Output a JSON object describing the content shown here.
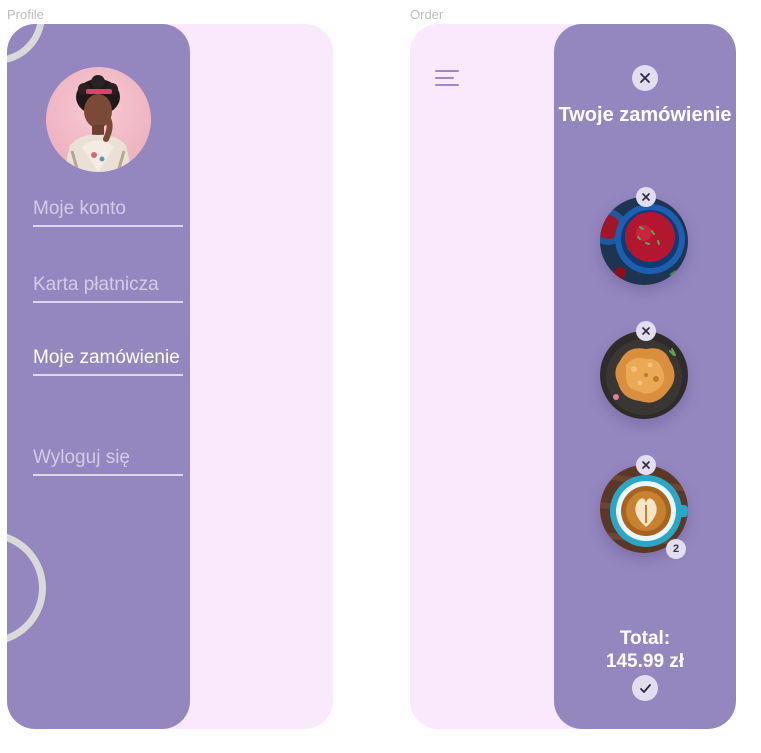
{
  "frames": {
    "profile_label": "Profile",
    "order_label": "Order"
  },
  "profile": {
    "menu": [
      {
        "label": "Moje konto",
        "active": false
      },
      {
        "label": "Karta płatnicza",
        "active": false
      },
      {
        "label": "Moje zamówienie",
        "active": true
      },
      {
        "label": "Wyloguj się",
        "active": false
      }
    ],
    "avatar_icon": "user-avatar-photo"
  },
  "order": {
    "title": "Twoje zamówienie",
    "items": [
      {
        "name": "beet-soup-bowl",
        "quantity": null
      },
      {
        "name": "fried-cutlet",
        "quantity": null
      },
      {
        "name": "latte-coffee-cup",
        "quantity": "2"
      }
    ],
    "total_label": "Total:",
    "total_value": "145.99 zł",
    "icons": {
      "menu": "hamburger-icon",
      "close": "close-icon",
      "remove": "close-icon",
      "confirm": "check-icon"
    }
  },
  "colors": {
    "panel": "#9487bf",
    "background": "#fae8fd",
    "button": "#e3deef",
    "text_active": "#ffffff",
    "text_inactive": "#d3cbe5"
  }
}
